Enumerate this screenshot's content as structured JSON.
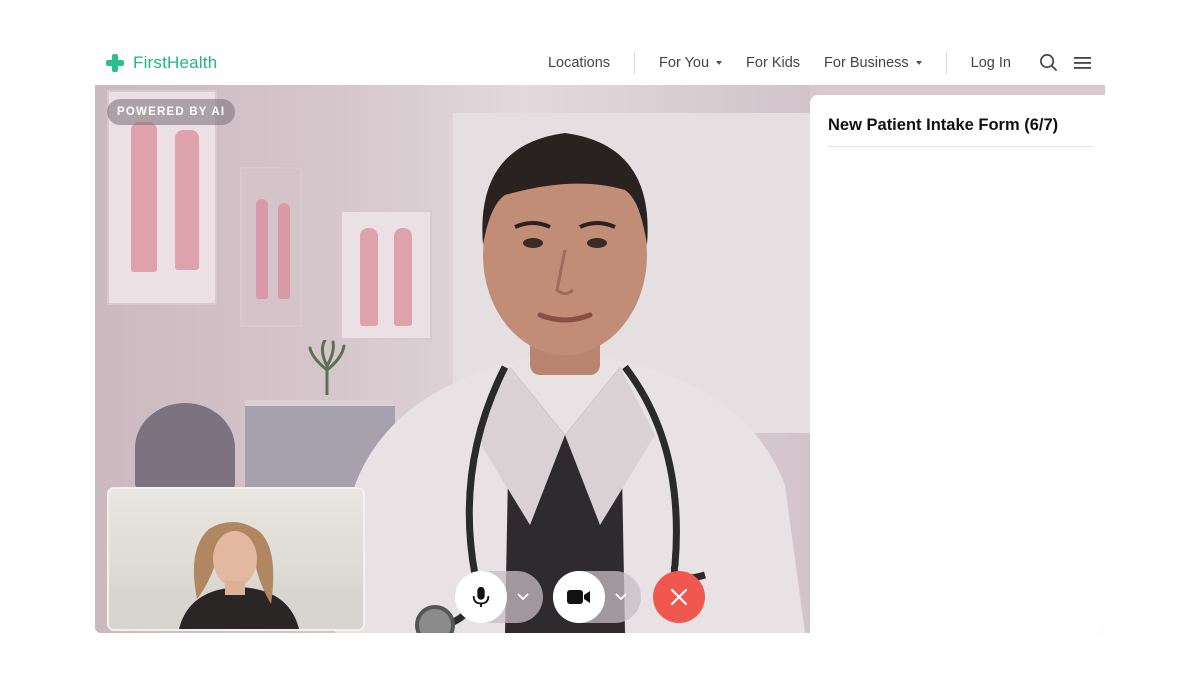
{
  "brand": {
    "name": "FirstHealth",
    "color": "#23b488"
  },
  "nav": {
    "links": [
      {
        "label": "Locations",
        "dropdown": false
      },
      {
        "label": "For You",
        "dropdown": true
      },
      {
        "label": "For Kids",
        "dropdown": false
      },
      {
        "label": "For Business",
        "dropdown": true
      }
    ],
    "login_label": "Log In",
    "icons": [
      "search-icon",
      "menu-icon"
    ]
  },
  "video": {
    "badge": "POWERED BY AI"
  },
  "controls": {
    "mic_icon": "microphone-icon",
    "camera_icon": "video-camera-icon",
    "end_icon": "close-icon",
    "end_color": "#f0584f"
  },
  "panel": {
    "title": "New Patient Intake Form (6/7)"
  }
}
